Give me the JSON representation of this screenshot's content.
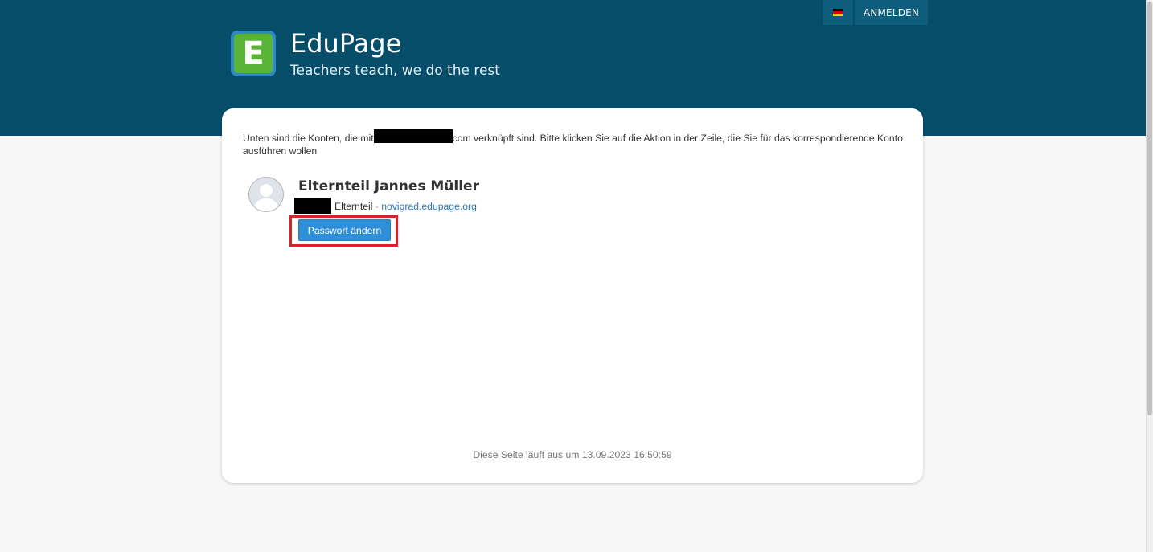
{
  "header": {
    "brand_title": "EduPage",
    "brand_tagline": "Teachers teach, we do the rest",
    "logo_letter": "E",
    "login_label": "ANMELDEN",
    "language_flag_icon": "german-flag-icon"
  },
  "intro": {
    "text_before": "Unten sind die Konten, die mit",
    "text_after": "com verknüpft sind. Bitte klicken Sie auf die Aktion in der Zeile, die Sie für das korrespondierende Konto ausführen wollen"
  },
  "account": {
    "name": "Elternteil Jannes Müller",
    "role": "Elternteil",
    "separator": "·",
    "domain": "novigrad.edupage.org",
    "avatar_icon": "user-avatar-icon",
    "action_label": "Passwort ändern"
  },
  "footer": {
    "expiry": "Diese Seite läuft aus um 13.09.2023 16:50:59"
  },
  "colors": {
    "header_bg": "#064d6a",
    "button_blue": "#2f8fd8",
    "highlight_red": "#d6242b",
    "logo_green": "#59b437",
    "logo_blue": "#2e8ac4"
  }
}
